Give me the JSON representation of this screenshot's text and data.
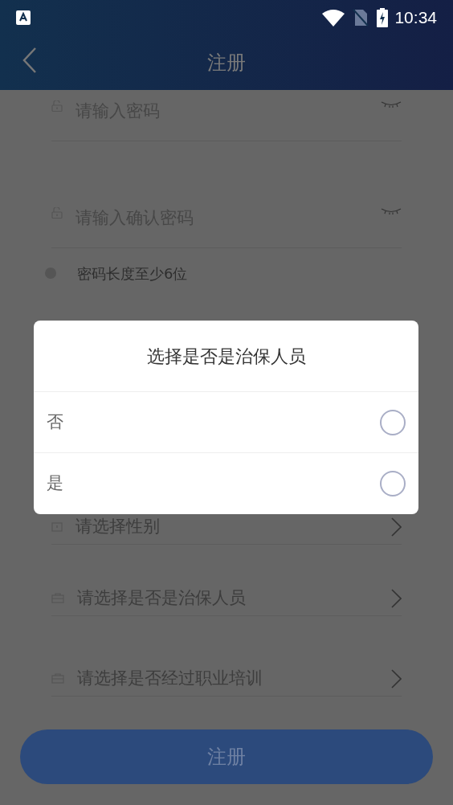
{
  "status_bar": {
    "time": "10:34"
  },
  "header": {
    "title": "注册"
  },
  "fields": [
    {
      "kind": "password",
      "placeholder": "请输入密码"
    },
    {
      "kind": "password",
      "placeholder": "请输入确认密码"
    }
  ],
  "hint": {
    "text": "密码长度至少6位"
  },
  "selects": [
    {
      "kind": "card",
      "placeholder": "请选择性别"
    },
    {
      "kind": "briefcase",
      "placeholder": "请选择是否是治保人员"
    },
    {
      "kind": "briefcase",
      "placeholder": "请选择是否经过职业培训"
    }
  ],
  "submit": "注册",
  "dialog": {
    "title": "选择是否是治保人员",
    "options": [
      {
        "label": "否",
        "selected": false
      },
      {
        "label": "是",
        "selected": false
      }
    ]
  }
}
